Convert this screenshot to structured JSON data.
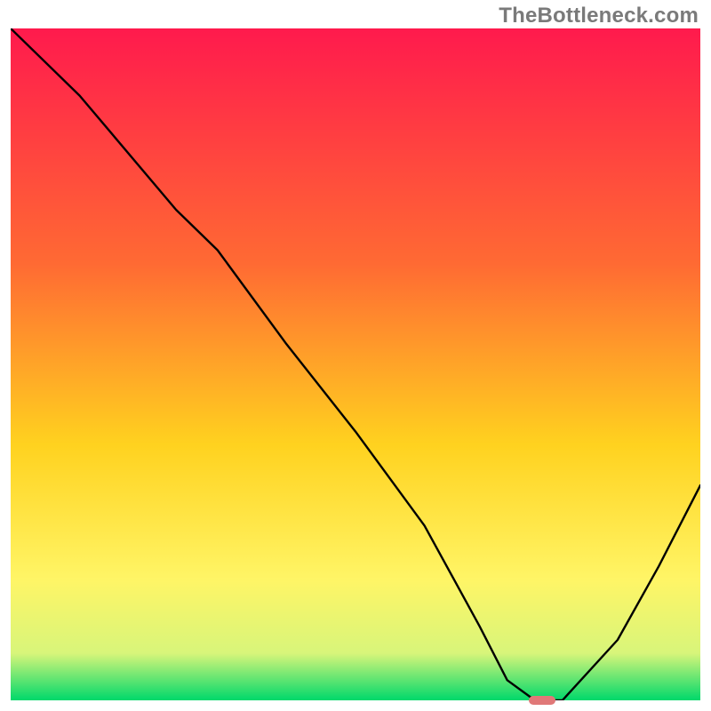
{
  "watermark": "TheBottleneck.com",
  "colors": {
    "gradient_top": "#ff1a4d",
    "gradient_mid1": "#ff6a33",
    "gradient_mid2": "#ffd21f",
    "gradient_mid3": "#fff566",
    "gradient_mid4": "#d8f57a",
    "gradient_bottom": "#00d86b",
    "curve": "#000000",
    "marker": "#e07878"
  },
  "chart_data": {
    "type": "line",
    "title": "",
    "xlabel": "",
    "ylabel": "",
    "xlim": [
      0,
      100
    ],
    "ylim": [
      0,
      100
    ],
    "legend": false,
    "grid": false,
    "series": [
      {
        "name": "bottleneck-curve",
        "x": [
          0,
          10,
          24,
          30,
          40,
          50,
          60,
          68,
          72,
          76,
          80,
          88,
          94,
          100
        ],
        "y": [
          100,
          90,
          73,
          67,
          53,
          40,
          26,
          11,
          3,
          0,
          0,
          9,
          20,
          32
        ]
      }
    ],
    "marker": {
      "name": "optimal-point",
      "x": 77,
      "y": 0
    }
  }
}
